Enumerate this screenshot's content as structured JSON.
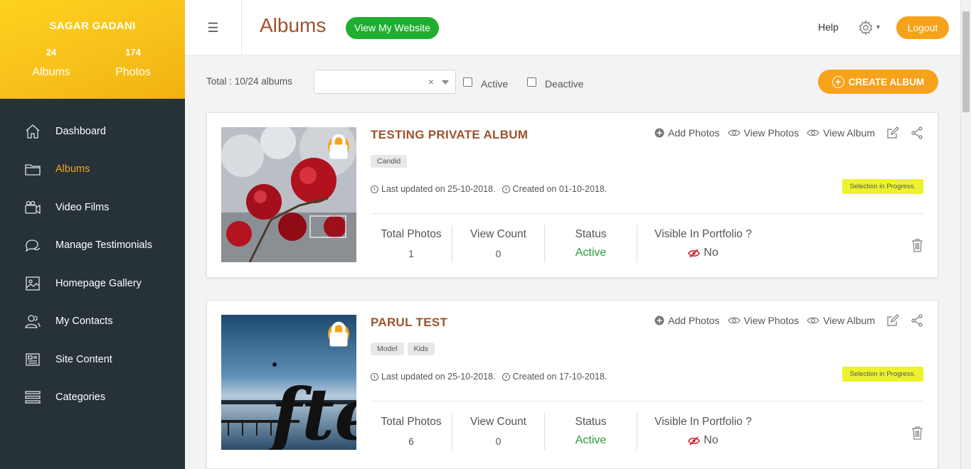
{
  "profile": {
    "name": "SAGAR GADANI",
    "albums_count": "24",
    "albums_label": "Albums",
    "photos_count": "174",
    "photos_label": "Photos"
  },
  "sidebar": {
    "items": [
      {
        "label": "Dashboard",
        "icon": "home-icon"
      },
      {
        "label": "Albums",
        "icon": "folder-icon",
        "active": true
      },
      {
        "label": "Video Films",
        "icon": "video-camera-icon"
      },
      {
        "label": "Manage Testimonials",
        "icon": "chat-icon"
      },
      {
        "label": "Homepage Gallery",
        "icon": "image-icon"
      },
      {
        "label": "My Contacts",
        "icon": "contacts-icon"
      },
      {
        "label": "Site Content",
        "icon": "newspaper-icon"
      },
      {
        "label": "Categories",
        "icon": "list-icon"
      }
    ]
  },
  "header": {
    "title": "Albums",
    "website_button": "View My Website",
    "help": "Help",
    "logout": "Logout"
  },
  "filters": {
    "total": "Total : 10/24 albums",
    "clear": "×",
    "active_label": "Active",
    "deactive_label": "Deactive",
    "create_button": "CREATE ALBUM"
  },
  "albums": [
    {
      "title": "TESTING PRIVATE ALBUM",
      "tags": [
        "Candid"
      ],
      "last_updated": "Last updated on 25-10-2018.",
      "created": "Created on 01-10-2018.",
      "actions": {
        "add": "Add Photos",
        "view_photos": "View Photos",
        "view_album": "View Album"
      },
      "badge": "Selection in Progress.",
      "stats": {
        "total_photos_label": "Total Photos",
        "total_photos": "1",
        "view_count_label": "View Count",
        "view_count": "0",
        "status_label": "Status",
        "status": "Active",
        "portfolio_label": "Visible In Portfolio ?",
        "portfolio": "No"
      }
    },
    {
      "title": "PARUL TEST",
      "tags": [
        "Model",
        "Kids"
      ],
      "last_updated": "Last updated on 25-10-2018.",
      "created": "Created on 17-10-2018.",
      "actions": {
        "add": "Add Photos",
        "view_photos": "View Photos",
        "view_album": "View Album"
      },
      "badge": "Selection in Progress.",
      "stats": {
        "total_photos_label": "Total Photos",
        "total_photos": "6",
        "view_count_label": "View Count",
        "view_count": "0",
        "status_label": "Status",
        "status": "Active",
        "portfolio_label": "Visible In Portfolio ?",
        "portfolio": "No"
      }
    }
  ],
  "colors": {
    "accent_orange": "#f7a21b",
    "sidebar_bg": "#263238",
    "title_brown": "#a0522d",
    "green": "#1fae2f",
    "badge_yellow": "#eef22b"
  }
}
